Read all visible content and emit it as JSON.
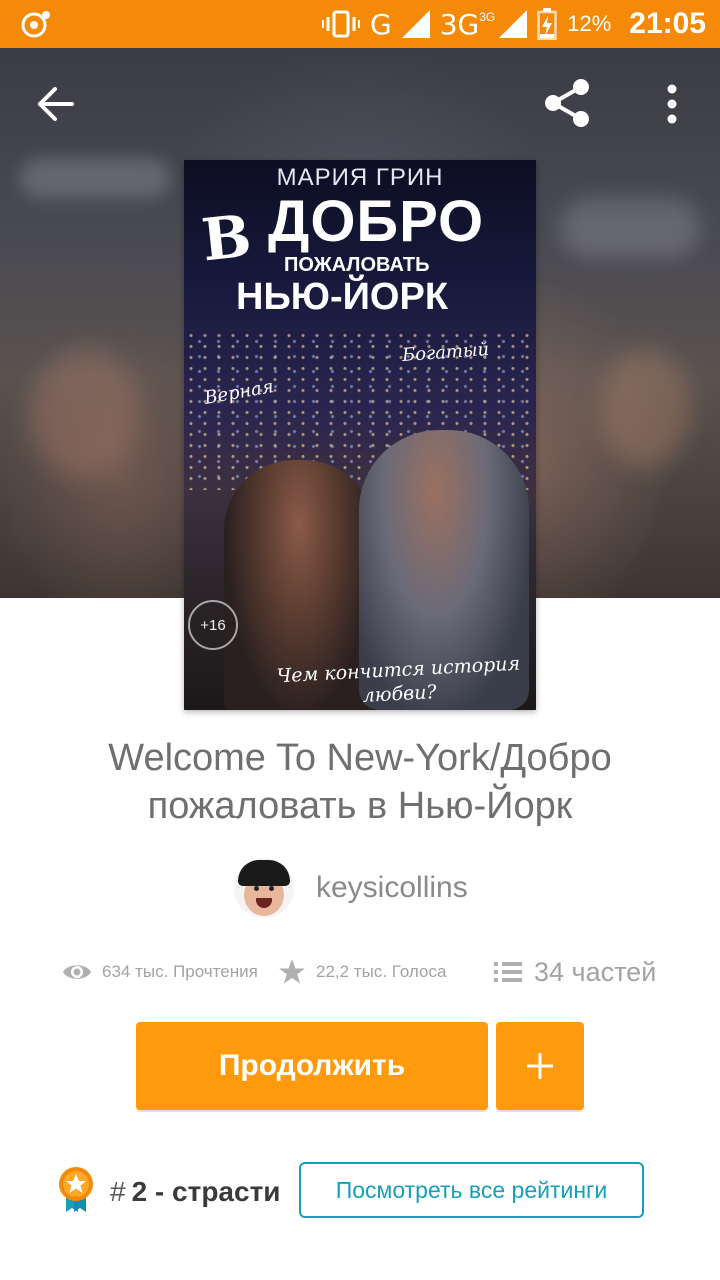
{
  "status_bar": {
    "network_g": "G",
    "network_3g": "3G",
    "network_3g_small": "3G",
    "battery": "12%",
    "time": "21:05"
  },
  "toolbar": {
    "back_icon": "arrow-left-icon",
    "share_icon": "share-icon",
    "more_icon": "more-vert-icon"
  },
  "cover": {
    "author": "МАРИЯ ГРИН",
    "title_letter": "В",
    "title_line1": "ДОБРО",
    "title_line2": "ПОЖАЛОВАТЬ",
    "title_line3": "НЬЮ-ЙОРК",
    "note_left": "Верная",
    "note_right": "Богатый",
    "age": "+16",
    "tagline": "Чем кончится история любви?"
  },
  "story": {
    "title": "Welcome To New-York/Добро пожаловать в Нью-Йорк",
    "author": "keysicollins"
  },
  "stats": {
    "reads": "634 тыс. Прочтения",
    "votes": "22,2 тыс. Голоса",
    "parts": "34 частей"
  },
  "actions": {
    "continue_label": "Продолжить",
    "add_label": "+"
  },
  "ranking": {
    "prefix": "#",
    "rank": "2 - страсти",
    "view_all_label": "Посмотреть все рейтинги"
  },
  "colors": {
    "status_bar": "#f58a08",
    "accent": "#ff9a0d",
    "link": "#15a0b8"
  }
}
